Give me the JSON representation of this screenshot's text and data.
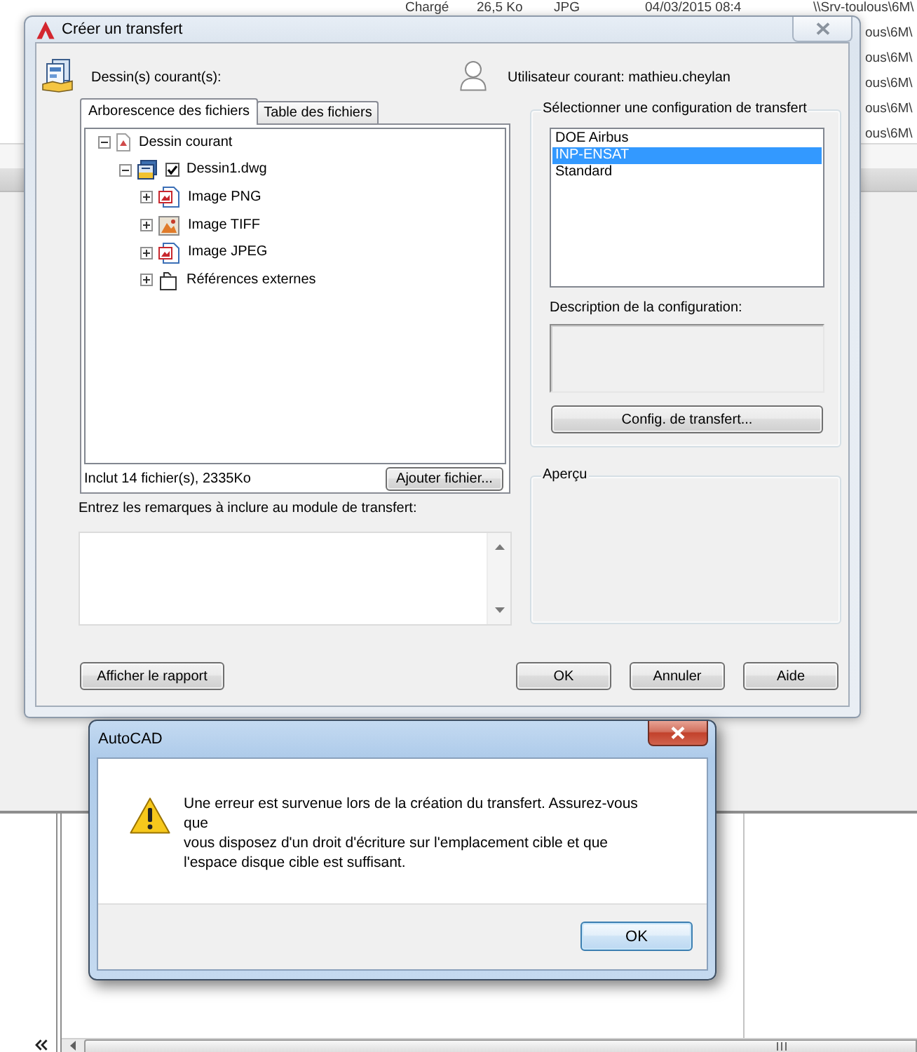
{
  "background_window": {
    "top_row": {
      "status": "Chargé",
      "size": "26,5 Ko",
      "type": "JPG",
      "date": "04/03/2015 08:4",
      "path": "\\\\Srv-toulous\\6M\\"
    },
    "path_fragments": [
      "ous\\6M\\",
      "ous\\6M\\",
      "ous\\6M\\",
      "ous\\6M\\",
      "ous\\6M\\"
    ]
  },
  "transfer_dialog": {
    "title": "Créer un transfert",
    "current_drawings_label": "Dessin(s) courant(s):",
    "current_user_label": "Utilisateur courant: mathieu.cheylan",
    "tabs": [
      {
        "label": "Arborescence des fichiers",
        "selected": true
      },
      {
        "label": "Table des fichiers",
        "selected": false
      }
    ],
    "tree": [
      {
        "label": "Dessin courant",
        "kind": "current",
        "expanded": true,
        "children": [
          {
            "label": "Dessin1.dwg",
            "kind": "dwg",
            "expanded": true,
            "checked": true,
            "children": [
              {
                "label": "Image PNG",
                "kind": "image",
                "expanded": false
              },
              {
                "label": "Image TIFF",
                "kind": "photo",
                "expanded": false
              },
              {
                "label": "Image JPEG",
                "kind": "image",
                "expanded": false
              },
              {
                "label": "Références externes",
                "kind": "xref",
                "expanded": false
              }
            ]
          }
        ]
      }
    ],
    "summary": "Inclut 14 fichier(s), 2335Ko",
    "add_file_button": "Ajouter fichier...",
    "notes_label": "Entrez les remarques à inclure au module de transfert:",
    "config_group": {
      "title": "Sélectionner une configuration de transfert",
      "items": [
        {
          "label": "DOE Airbus",
          "selected": false
        },
        {
          "label": "INP-ENSAT",
          "selected": true
        },
        {
          "label": "Standard",
          "selected": false
        }
      ],
      "description_label": "Description de la configuration:",
      "setup_button": "Config. de transfert..."
    },
    "preview_group": {
      "title": "Aperçu"
    },
    "report_button": "Afficher le rapport",
    "buttons": [
      "OK",
      "Annuler",
      "Aide"
    ]
  },
  "error_dialog": {
    "title": "AutoCAD",
    "message_lines": [
      "Une erreur est survenue lors de la création du transfert. Assurez-vous",
      "que",
      "vous disposez d'un droit d'écriture sur l'emplacement cible et que",
      "l'espace disque cible est suffisant."
    ],
    "button": "OK"
  }
}
